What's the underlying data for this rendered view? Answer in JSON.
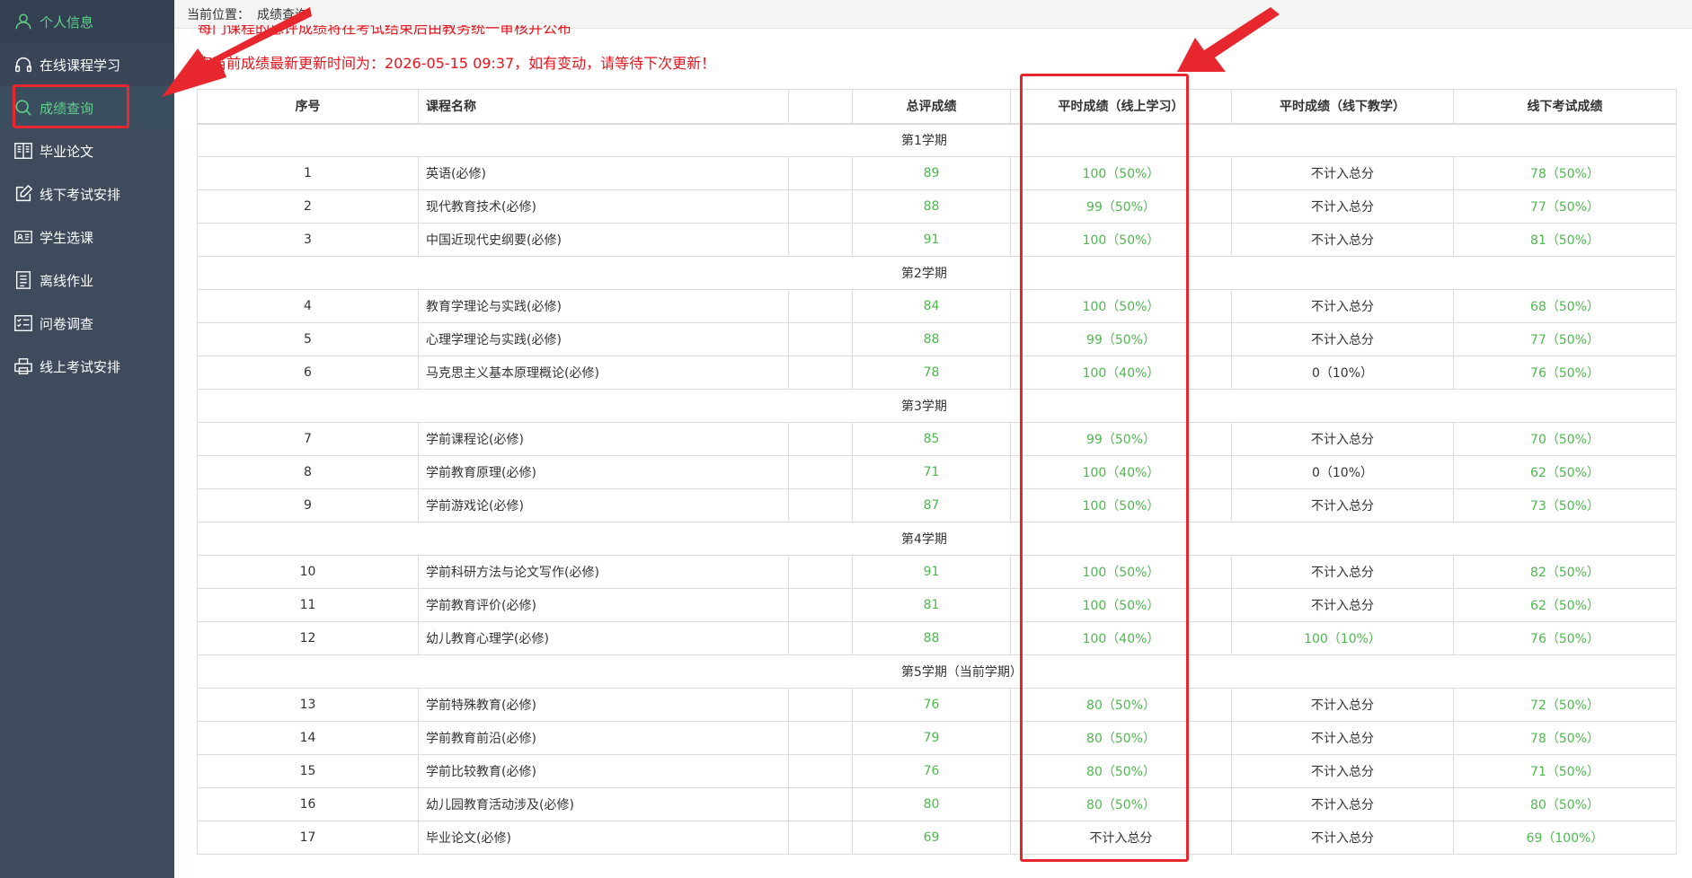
{
  "sidebar": {
    "items": [
      {
        "label": "个人信息",
        "icon": "user-icon"
      },
      {
        "label": "在线课程学习",
        "icon": "headphones-icon"
      },
      {
        "label": "成绩查询",
        "icon": "search-icon"
      },
      {
        "label": "毕业论文",
        "icon": "book-icon"
      },
      {
        "label": "线下考试安排",
        "icon": "edit-icon"
      },
      {
        "label": "学生选课",
        "icon": "id-card-icon"
      },
      {
        "label": "离线作业",
        "icon": "document-icon"
      },
      {
        "label": "问卷调查",
        "icon": "checklist-icon"
      },
      {
        "label": "线上考试安排",
        "icon": "printer-icon"
      }
    ]
  },
  "breadcrumb": {
    "prefix": "当前位置：",
    "current": "成绩查询"
  },
  "notice": {
    "line1": "每门课程的总评成绩将在考试结束后由教务统一审核并公布",
    "line2": "您当前成绩最新更新时间为：2026-05-15 09:37，如有变动，请等待下次更新！"
  },
  "table": {
    "headers": [
      "序号",
      "课程名称",
      "",
      "总评成绩",
      "平时成绩（线上学习）",
      "平时成绩（线下教学）",
      "线下考试成绩"
    ],
    "terms": [
      {
        "label": "第1学期",
        "rows": [
          {
            "no": "1",
            "name": "英语(必修)",
            "total": "89",
            "online": "100（50%）",
            "offline": "不计入总分",
            "exam": "78（50%）"
          },
          {
            "no": "2",
            "name": "现代教育技术(必修)",
            "total": "88",
            "online": "99（50%）",
            "offline": "不计入总分",
            "exam": "77（50%）"
          },
          {
            "no": "3",
            "name": "中国近现代史纲要(必修)",
            "total": "91",
            "online": "100（50%）",
            "offline": "不计入总分",
            "exam": "81（50%）"
          }
        ]
      },
      {
        "label": "第2学期",
        "rows": [
          {
            "no": "4",
            "name": "教育学理论与实践(必修)",
            "total": "84",
            "online": "100（50%）",
            "offline": "不计入总分",
            "exam": "68（50%）"
          },
          {
            "no": "5",
            "name": "心理学理论与实践(必修)",
            "total": "88",
            "online": "99（50%）",
            "offline": "不计入总分",
            "exam": "77（50%）"
          },
          {
            "no": "6",
            "name": "马克思主义基本原理概论(必修)",
            "total": "78",
            "online": "100（40%）",
            "offline": "0（10%）",
            "exam": "76（50%）"
          }
        ]
      },
      {
        "label": "第3学期",
        "rows": [
          {
            "no": "7",
            "name": "学前课程论(必修)",
            "total": "85",
            "online": "99（50%）",
            "offline": "不计入总分",
            "exam": "70（50%）"
          },
          {
            "no": "8",
            "name": "学前教育原理(必修)",
            "total": "71",
            "online": "100（40%）",
            "offline": "0（10%）",
            "exam": "62（50%）"
          },
          {
            "no": "9",
            "name": "学前游戏论(必修)",
            "total": "87",
            "online": "100（50%）",
            "offline": "不计入总分",
            "exam": "73（50%）"
          }
        ]
      },
      {
        "label": "第4学期",
        "rows": [
          {
            "no": "10",
            "name": "学前科研方法与论文写作(必修)",
            "total": "91",
            "online": "100（50%）",
            "offline": "不计入总分",
            "exam": "82（50%）"
          },
          {
            "no": "11",
            "name": "学前教育评价(必修)",
            "total": "81",
            "online": "100（50%）",
            "offline": "不计入总分",
            "exam": "62（50%）"
          },
          {
            "no": "12",
            "name": "幼儿教育心理学(必修)",
            "total": "88",
            "online": "100（40%）",
            "offline": "100（10%）",
            "offline_green": true,
            "exam": "76（50%）"
          }
        ]
      },
      {
        "label": "第5学期（当前学期）",
        "rows": [
          {
            "no": "13",
            "name": "学前特殊教育(必修)",
            "total": "76",
            "online": "80（50%）",
            "offline": "不计入总分",
            "exam": "72（50%）"
          },
          {
            "no": "14",
            "name": "学前教育前沿(必修)",
            "total": "79",
            "online": "80（50%）",
            "offline": "不计入总分",
            "exam": "78（50%）"
          },
          {
            "no": "15",
            "name": "学前比较教育(必修)",
            "total": "76",
            "online": "80（50%）",
            "offline": "不计入总分",
            "exam": "71（50%）"
          },
          {
            "no": "16",
            "name": "幼儿园教育活动涉及(必修)",
            "total": "80",
            "online": "80（50%）",
            "offline": "不计入总分",
            "exam": "80（50%）"
          },
          {
            "no": "17",
            "name": "毕业论文(必修)",
            "total": "69",
            "online": "不计入总分",
            "online_plain": true,
            "offline": "不计入总分",
            "exam": "69（100%）"
          }
        ]
      }
    ]
  },
  "colors": {
    "sidebar_bg": "#3f4a5c",
    "accent_green": "#4db84d",
    "notice_red": "#e8131c",
    "annotation_red": "#e8262e"
  }
}
